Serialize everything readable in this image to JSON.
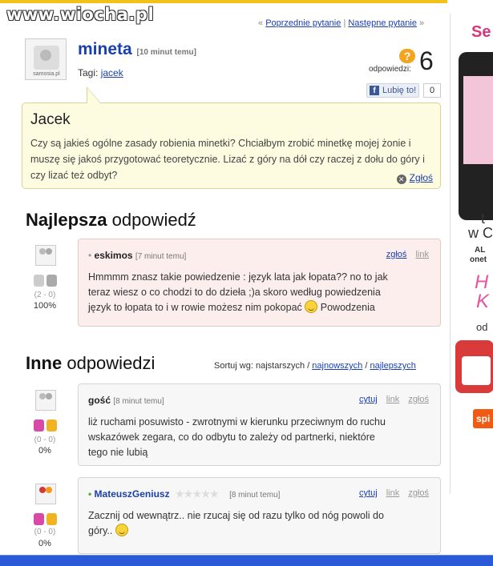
{
  "watermark": "www.wiocha.pl",
  "nav": {
    "prefix": "«",
    "prev": "Poprzednie pytanie",
    "sep": "|",
    "next": "Następne pytanie",
    "suffix": "»"
  },
  "question": {
    "avatar_caption": "samosia.pl",
    "title": "mineta",
    "time": "[10 minut temu]",
    "tags_label": "Tagi:",
    "tag": "jacek",
    "answers_badge": "?",
    "answers_count": "6",
    "answers_label": "odpowiedzi:",
    "like_label": "Lubię to!",
    "like_count": "0",
    "author": "Jacek",
    "body": "Czy są jakieś ogólne zasady robienia minetki? Chciałbym zrobić minetkę mojej żonie i muszę się jakoś przygotować teoretycznie. Lizać z góry na dół czy raczej z dołu do góry i czy lizać też odbyt?",
    "report": "Zgłoś"
  },
  "best": {
    "title_bold": "Najlepsza",
    "title_rest": " odpowiedź",
    "answer": {
      "author": "eskimos",
      "time": "[7 minut temu]",
      "report": "zgłoś",
      "link": "link",
      "text_1": "Hmmmm znasz takie powiedzenie : język lata jak łopata?? no to jak",
      "text_2": "teraz wiesz o co chodzi to do dzieła ;)a skoro według powiedzenia",
      "text_3": "język to łopata to i w rowie możesz nim pokopać",
      "text_3b": " Powodzenia",
      "votes": "(2 - 0)",
      "pct": "100%"
    }
  },
  "other": {
    "title_bold": "Inne",
    "title_rest": " odpowiedzi",
    "sort_label": "Sortuj wg: najstarszych /",
    "sort_newest": "najnowszych",
    "sort_sep": "/",
    "sort_best": "najlepszych",
    "answers": [
      {
        "author": "gość",
        "time": "[8 minut temu]",
        "quote": "cytuj",
        "link": "link",
        "report": "zgłoś",
        "text_1": "liż ruchami posuwisto - zwrotnymi w kierunku przeciwnym do ruchu",
        "text_2": "wskazówek zegara, co do odbytu to zależy od partnerki, niektóre",
        "text_3": "tego nie lubią",
        "votes": "(0 - 0)",
        "pct": "0%"
      },
      {
        "author": "MateuszGeniusz",
        "stars": "★★★★★",
        "time": "[8 minut temu]",
        "quote": "cytuj",
        "link": "link",
        "report": "zgłoś",
        "text_1": "Zacznij od wewnątrz.. nie rzucaj się od razu tylko od nóg powoli do",
        "text_2": "góry..",
        "votes": "(0 - 0)",
        "pct": "0%"
      }
    ]
  },
  "ad": {
    "l1": "Se",
    "l2": "t",
    "l3": "w C",
    "l4": "AL",
    "l5": "onet",
    "l6": "H",
    "l7": "K",
    "l8": "od",
    "l9": "spi"
  },
  "colors": {
    "link": "#1a3fae",
    "question_bg": "#fdfbe0",
    "best_bg": "#fdeeee",
    "accent": "#f4a41e"
  }
}
